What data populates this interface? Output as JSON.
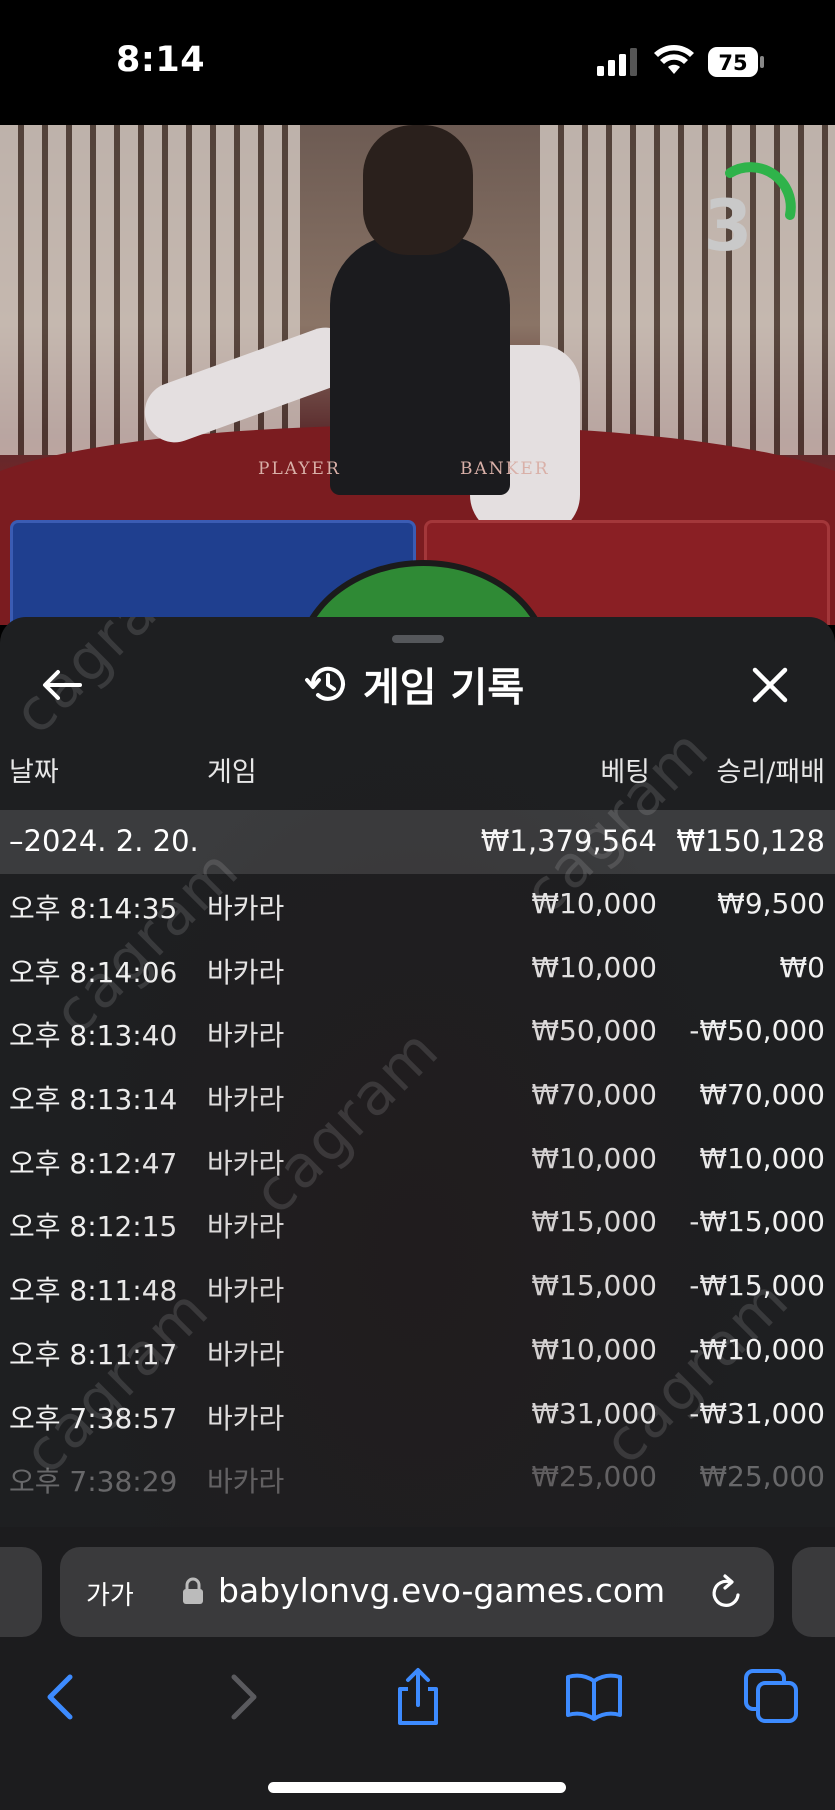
{
  "status_bar": {
    "time": "8:14",
    "battery": "75",
    "icons": [
      "signal-icon",
      "wifi-icon",
      "battery-icon"
    ]
  },
  "video": {
    "timer": "3",
    "player_label": "PLAYER",
    "banker_label": "BANKER"
  },
  "panel": {
    "title": "게임 기록",
    "icons": [
      "back-arrow-icon",
      "history-icon",
      "close-icon"
    ],
    "columns": {
      "date": "날짜",
      "game": "게임",
      "bet": "베팅",
      "win_loss": "승리/패배"
    },
    "day_summary": {
      "date": "–2024. 2. 20.",
      "bet": "₩1,379,564",
      "win_loss": "₩150,128"
    },
    "rows": [
      {
        "time": "오후 8:14:35",
        "game": "바카라",
        "bet": "₩10,000",
        "win_loss": "₩9,500"
      },
      {
        "time": "오후 8:14:06",
        "game": "바카라",
        "bet": "₩10,000",
        "win_loss": "₩0"
      },
      {
        "time": "오후 8:13:40",
        "game": "바카라",
        "bet": "₩50,000",
        "win_loss": "-₩50,000"
      },
      {
        "time": "오후 8:13:14",
        "game": "바카라",
        "bet": "₩70,000",
        "win_loss": "₩70,000"
      },
      {
        "time": "오후 8:12:47",
        "game": "바카라",
        "bet": "₩10,000",
        "win_loss": "₩10,000"
      },
      {
        "time": "오후 8:12:15",
        "game": "바카라",
        "bet": "₩15,000",
        "win_loss": "-₩15,000"
      },
      {
        "time": "오후 8:11:48",
        "game": "바카라",
        "bet": "₩15,000",
        "win_loss": "-₩15,000"
      },
      {
        "time": "오후 8:11:17",
        "game": "바카라",
        "bet": "₩10,000",
        "win_loss": "-₩10,000"
      },
      {
        "time": "오후 7:38:57",
        "game": "바카라",
        "bet": "₩31,000",
        "win_loss": "-₩31,000"
      },
      {
        "time": "오후 7:38:29",
        "game": "바카라",
        "bet": "₩25,000",
        "win_loss": "₩25,000"
      }
    ],
    "watermark": "cagram"
  },
  "browser": {
    "text_size_label": "가가",
    "url": "babylonvg.evo-games.com",
    "icons": [
      "lock-icon",
      "reload-icon",
      "back-icon",
      "forward-icon",
      "share-icon",
      "bookmarks-icon",
      "tabs-icon"
    ]
  }
}
